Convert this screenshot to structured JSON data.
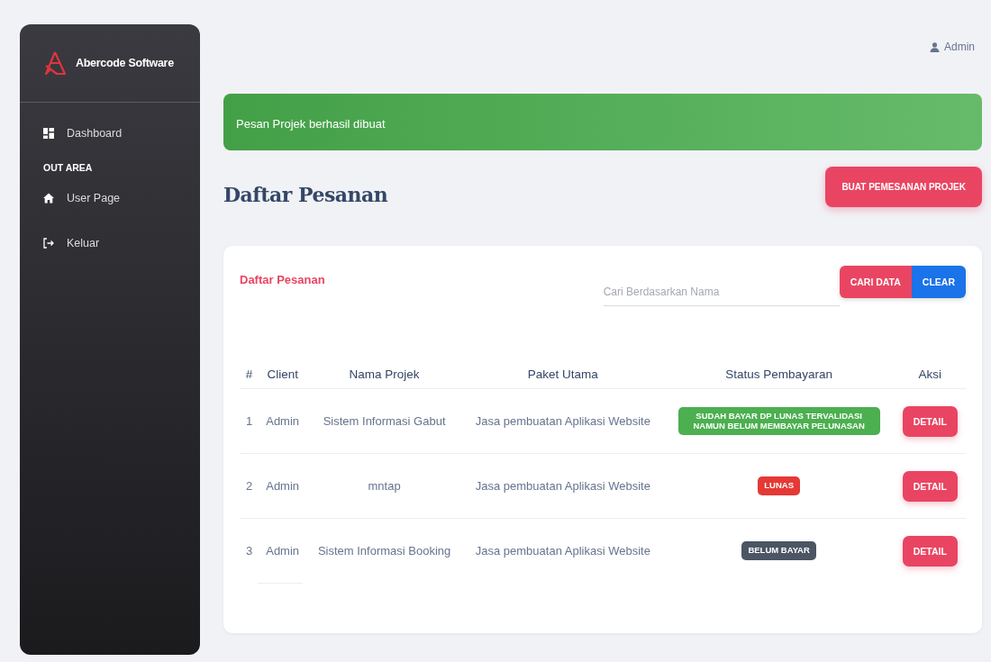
{
  "sidebar": {
    "brand": "Abercode Software",
    "items": [
      {
        "kind": "link",
        "label": "Dashboard"
      },
      {
        "kind": "heading",
        "label": "OUT AREA"
      },
      {
        "kind": "link",
        "label": "User Page"
      },
      {
        "kind": "link",
        "label": "Keluar"
      }
    ]
  },
  "user": {
    "label": "Admin"
  },
  "alert": {
    "text": "Pesan Projek berhasil dibuat"
  },
  "page_title": "Daftar Pesanan",
  "create_button": "BUAT PEMESANAN PROJEK",
  "card": {
    "title": "Daftar Pesanan",
    "search": {
      "placeholder": "Cari Berdasarkan Nama"
    },
    "search_button": "CARI DATA",
    "clear_button": "CLEAR",
    "table": {
      "columns": [
        "#",
        "Client",
        "Nama Projek",
        "Paket Utama",
        "Status Pembayaran",
        "Aksi"
      ],
      "rows": [
        {
          "no": "1",
          "client": "Admin",
          "project": "Sistem Informasi Gabut",
          "package": "Jasa pembuatan Aplikasi Website",
          "status": "SUDAH BAYAR DP LUNAS TERVALIDASI NAMUN BELUM MEMBAYAR PELUNASAN",
          "color": "#4caf50",
          "action": "DETAIL"
        },
        {
          "no": "2",
          "client": "Admin",
          "project": "mntap",
          "package": "Jasa pembuatan Aplikasi Website",
          "status": "LUNAS",
          "color": "#e53935",
          "action": "DETAIL"
        },
        {
          "no": "3",
          "client": "Admin",
          "project": "Sistem Informasi Booking",
          "package": "Jasa pembuatan Aplikasi Website",
          "status": "BELUM BAYAR",
          "color": "#4b5563",
          "action": "DETAIL"
        }
      ]
    }
  }
}
